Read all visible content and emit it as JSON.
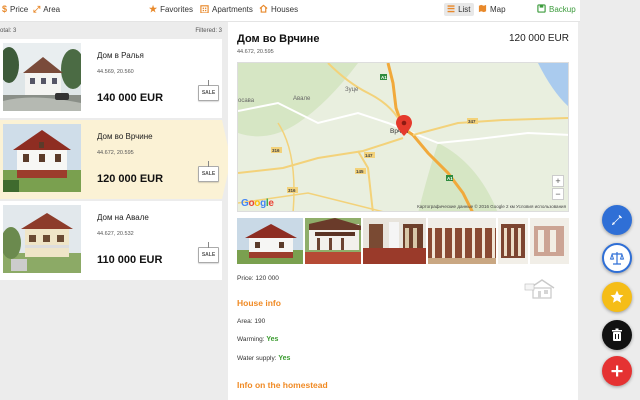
{
  "toolbar": {
    "price": "Price",
    "area": "Area",
    "favorites": "Favorites",
    "apartments": "Apartments",
    "houses": "Houses",
    "list": "List",
    "map": "Map",
    "backup": "Backup"
  },
  "list": {
    "total": "otal: 3",
    "filtered": "Filtered: 3",
    "items": [
      {
        "title": "Дом в Ралья",
        "coords": "44.569, 20.560",
        "price": "140 000 EUR",
        "sale": "SALE"
      },
      {
        "title": "Дом во Врчине",
        "coords": "44.672, 20.595",
        "price": "120 000 EUR",
        "sale": "SALE"
      },
      {
        "title": "Дом на Авале",
        "coords": "44.627, 20.532",
        "price": "110 000 EUR",
        "sale": "SALE"
      }
    ]
  },
  "detail": {
    "title": "Дом во Врчине",
    "price": "120 000 EUR",
    "coords": "44.672, 20.595",
    "map": {
      "labels": {
        "avale": "Авале",
        "zuce": "Зуце",
        "vrcin": "Врчин",
        "sava": "осава"
      },
      "roads": [
        "A1",
        "347",
        "145",
        "147",
        "316",
        "316",
        "A1"
      ],
      "credit": "Картографические данные © 2016 Google   2 км        Условия использования",
      "google": "Google",
      "zoom_in": "+",
      "zoom_out": "−"
    },
    "price_line": "Price: 120 000",
    "house_info_title": "House info",
    "area": "Area: 190",
    "warming_label": "Warming: ",
    "warming_value": "Yes",
    "water_label": "Water supply: ",
    "water_value": "Yes",
    "homestead_title": "Info on the homestead"
  },
  "fab_icons": [
    "pencil-icon",
    "scales-icon",
    "star-icon",
    "trash-icon",
    "plus-icon"
  ],
  "colors": {
    "accent": "#f08a24",
    "selected": "#fbf2d5",
    "yes": "#3a9b2f",
    "fab_edit": "#2f6fd6",
    "fab_compare": "#2f6fd6",
    "fab_favorite": "#f5bd17",
    "fab_delete": "#111111",
    "fab_add": "#e53232"
  }
}
